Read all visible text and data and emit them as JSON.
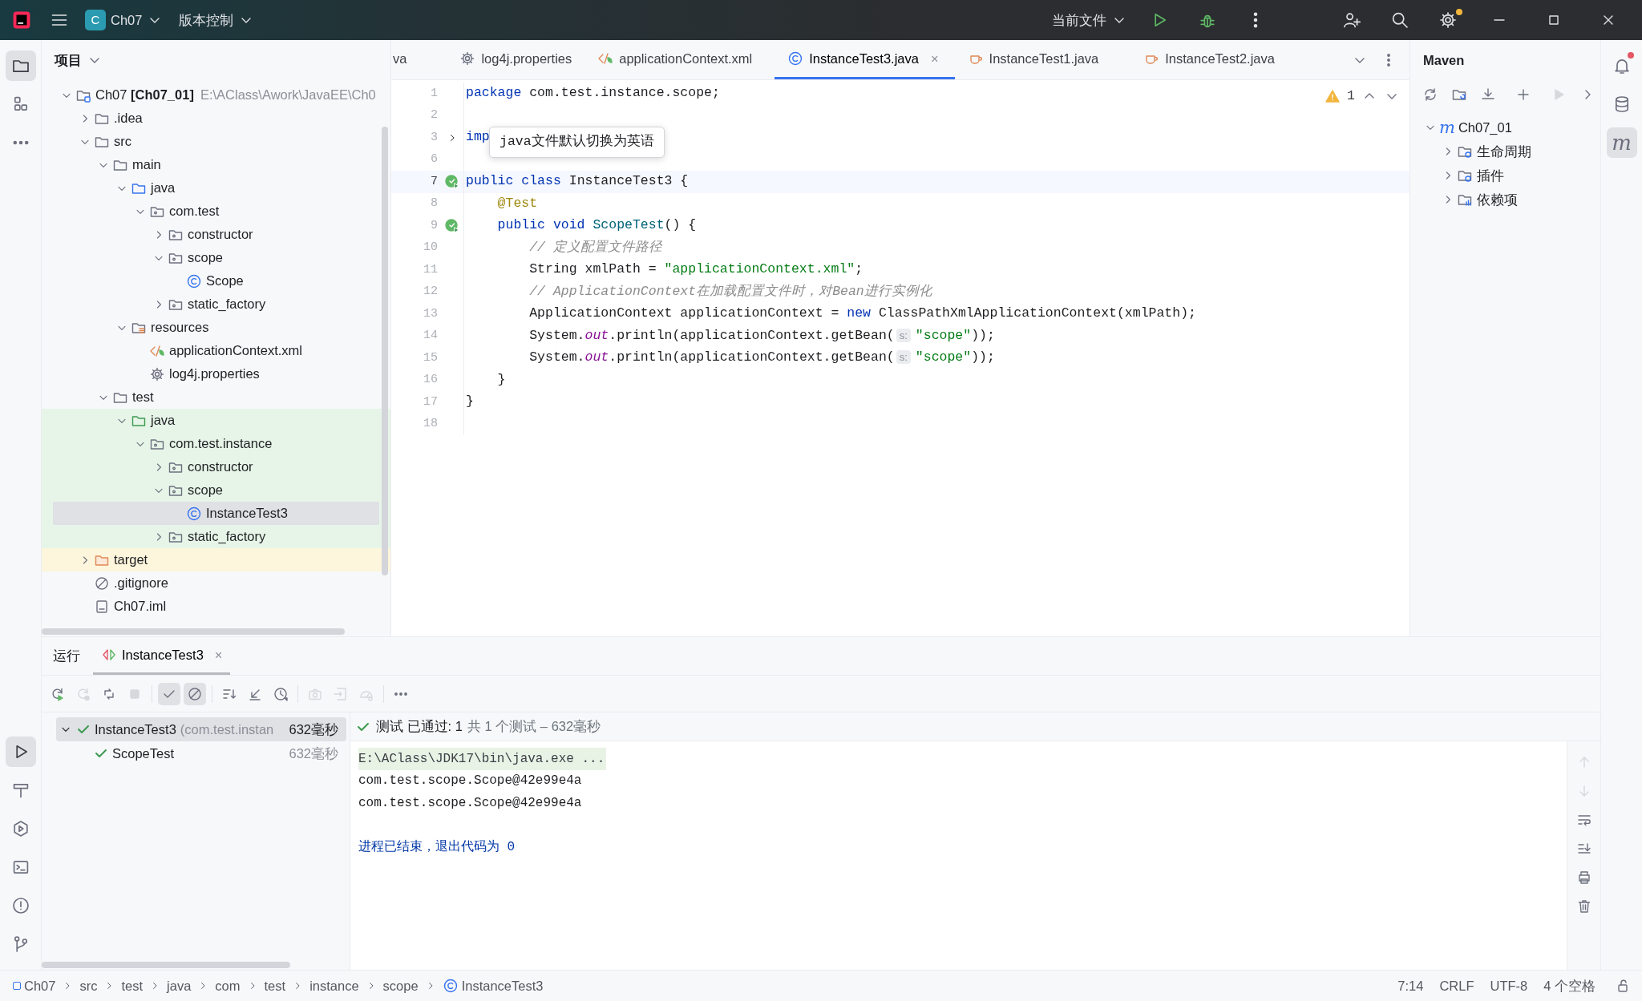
{
  "title_bar": {
    "project_badge": "C",
    "project": "Ch07",
    "vcs": "版本控制",
    "run_config": "当前文件",
    "settings_alert": true
  },
  "left_strip": {
    "top": [
      {
        "kind": "project",
        "selected": true
      },
      {
        "kind": "structure",
        "selected": false
      },
      {
        "kind": "more",
        "selected": false
      }
    ],
    "bottom": [
      {
        "kind": "run",
        "selected": true
      },
      {
        "kind": "build",
        "selected": false
      },
      {
        "kind": "services",
        "selected": false
      },
      {
        "kind": "terminal",
        "selected": false
      },
      {
        "kind": "problems",
        "selected": false
      },
      {
        "kind": "git",
        "selected": false
      }
    ]
  },
  "project_panel": {
    "title": "项目",
    "tree": [
      {
        "label": "Ch07 **[Ch07_01]**",
        "detail": "E:\\AClass\\Awork\\JavaEE\\Ch0",
        "kind": "module",
        "expanded": true,
        "selected": false,
        "children": [
          {
            "label": ".idea",
            "kind": "folder",
            "expanded": false,
            "selected": false
          },
          {
            "label": "src",
            "kind": "folder",
            "expanded": true,
            "selected": false,
            "children": [
              {
                "label": "main",
                "kind": "folder",
                "expanded": true,
                "selected": false,
                "children": [
                  {
                    "label": "java",
                    "kind": "source_root",
                    "expanded": true,
                    "selected": false,
                    "children": [
                      {
                        "label": "com.test",
                        "kind": "package",
                        "expanded": true,
                        "selected": false,
                        "children": [
                          {
                            "label": "constructor",
                            "kind": "package",
                            "expanded": false,
                            "selected": false
                          },
                          {
                            "label": "scope",
                            "kind": "package",
                            "expanded": true,
                            "selected": false,
                            "children": [
                              {
                                "label": "Scope",
                                "kind": "class",
                                "selected": false
                              }
                            ]
                          },
                          {
                            "label": "static_factory",
                            "kind": "package",
                            "expanded": false,
                            "selected": false
                          }
                        ]
                      }
                    ]
                  },
                  {
                    "label": "resources",
                    "kind": "resources",
                    "expanded": true,
                    "selected": false,
                    "children": [
                      {
                        "label": "applicationContext.xml",
                        "kind": "xml",
                        "selected": false
                      },
                      {
                        "label": "log4j.properties",
                        "kind": "properties",
                        "selected": false
                      }
                    ]
                  }
                ]
              },
              {
                "label": "test",
                "kind": "folder",
                "expanded": true,
                "selected": false,
                "children": [
                  {
                    "label": "java",
                    "kind": "test_root",
                    "expanded": true,
                    "selected": false,
                    "children": [
                      {
                        "label": "com.test.instance",
                        "kind": "package",
                        "expanded": true,
                        "selected": false,
                        "children": [
                          {
                            "label": "constructor",
                            "kind": "package",
                            "expanded": false,
                            "selected": false
                          },
                          {
                            "label": "scope",
                            "kind": "package",
                            "expanded": true,
                            "selected": false,
                            "children": [
                              {
                                "label": "InstanceTest3",
                                "kind": "class",
                                "selected": true
                              }
                            ]
                          },
                          {
                            "label": "static_factory",
                            "kind": "package",
                            "expanded": false,
                            "selected": false
                          }
                        ]
                      }
                    ]
                  }
                ]
              }
            ]
          },
          {
            "label": "target",
            "kind": "excluded",
            "expanded": false,
            "selected": false
          },
          {
            "label": ".gitignore",
            "kind": "ignore",
            "selected": false
          },
          {
            "label": "Ch07.iml",
            "kind": "iml",
            "selected": false
          }
        ]
      }
    ]
  },
  "editor_tabs": [
    {
      "label": "va",
      "kind": "cut",
      "selected": false
    },
    {
      "label": "log4j.properties",
      "kind": "properties",
      "selected": false
    },
    {
      "label": "applicationContext.xml",
      "kind": "xml",
      "selected": false
    },
    {
      "label": "InstanceTest3.java",
      "kind": "class",
      "selected": true,
      "close": "×"
    },
    {
      "label": "InstanceTest1.java",
      "kind": "java",
      "selected": false
    },
    {
      "label": "InstanceTest2.java",
      "kind": "java",
      "selected": false
    }
  ],
  "editor": {
    "warnings": "1",
    "tooltip": "java文件默认切换为英语",
    "lines": [
      {
        "number": "1",
        "tokens": [
          {
            "kind": "kw",
            "text": "package"
          },
          {
            "kind": "t",
            "text": " com.test.instance.scope;"
          }
        ]
      },
      {
        "number": "2"
      },
      {
        "number": "3",
        "fold": true,
        "tokens": [
          {
            "kind": "kw",
            "text": "imp"
          }
        ]
      },
      {
        "number": "6"
      },
      {
        "number": "7",
        "current": true,
        "run_marker": true,
        "tokens": [
          {
            "kind": "kw",
            "text": "public class"
          },
          {
            "kind": "t",
            "text": " InstanceTest3 {"
          }
        ]
      },
      {
        "number": "8",
        "tokens": [
          {
            "kind": "ann",
            "text": "    @Test"
          }
        ]
      },
      {
        "number": "9",
        "run_marker": true,
        "tokens": [
          {
            "kind": "kw",
            "text": "    public void"
          },
          {
            "kind": "fn",
            "text": " ScopeTest"
          },
          {
            "kind": "t",
            "text": "() {"
          }
        ]
      },
      {
        "number": "10",
        "tokens": [
          {
            "kind": "cm",
            "text": "        // 定义配置文件路径"
          }
        ]
      },
      {
        "number": "11",
        "tokens": [
          {
            "kind": "t",
            "text": "        String xmlPath = "
          },
          {
            "kind": "str",
            "text": "\"applicationContext.xml\""
          },
          {
            "kind": "t",
            "text": ";"
          }
        ]
      },
      {
        "number": "12",
        "tokens": [
          {
            "kind": "cm",
            "text": "        // ApplicationContext在加载配置文件时，对Bean进行实例化"
          }
        ]
      },
      {
        "number": "13",
        "tokens": [
          {
            "kind": "t",
            "text": "        ApplicationContext applicationContext = "
          },
          {
            "kind": "kw",
            "text": "new"
          },
          {
            "kind": "t",
            "text": " ClassPathXmlApplicationContext(xmlPath);"
          }
        ]
      },
      {
        "number": "14",
        "tokens": [
          {
            "kind": "t",
            "text": "        System."
          },
          {
            "kind": "static",
            "text": "out"
          },
          {
            "kind": "t",
            "text": ".println(applicationContext.getBean("
          },
          {
            "kind": "hint",
            "text": "s:"
          },
          {
            "kind": "str",
            "text": "\"scope\""
          },
          {
            "kind": "t",
            "text": "));"
          }
        ]
      },
      {
        "number": "15",
        "tokens": [
          {
            "kind": "t",
            "text": "        System."
          },
          {
            "kind": "static",
            "text": "out"
          },
          {
            "kind": "t",
            "text": ".println(applicationContext.getBean("
          },
          {
            "kind": "hint",
            "text": "s:"
          },
          {
            "kind": "str",
            "text": "\"scope\""
          },
          {
            "kind": "t",
            "text": "));"
          }
        ]
      },
      {
        "number": "16",
        "tokens": [
          {
            "kind": "t",
            "text": "    }"
          }
        ]
      },
      {
        "number": "17",
        "tokens": [
          {
            "kind": "t",
            "text": "}"
          }
        ]
      },
      {
        "number": "18"
      }
    ]
  },
  "maven": {
    "title": "Maven",
    "toolbar": [
      {
        "kind": "reload",
        "disabled": false
      },
      {
        "kind": "reimport",
        "disabled": false
      },
      {
        "kind": "download",
        "disabled": false
      },
      {
        "kind": "add",
        "disabled": false
      },
      {
        "kind": "execute",
        "disabled": true
      },
      {
        "kind": "expand",
        "disabled": false
      }
    ],
    "tree": [
      {
        "label": "Ch07_01",
        "glyph": "m",
        "expanded": true,
        "children": [
          {
            "label": "生命周期",
            "kind": "lifecycle",
            "expanded": false
          },
          {
            "label": "插件",
            "kind": "plugins",
            "expanded": false
          },
          {
            "label": "依赖项",
            "kind": "dependencies",
            "expanded": false
          }
        ]
      }
    ]
  },
  "right_strip": [
    {
      "kind": "notifications",
      "selected": false,
      "alert": true
    },
    {
      "kind": "database",
      "selected": false
    },
    {
      "kind": "maven",
      "glyph": "m",
      "selected": true
    }
  ],
  "run_panel": {
    "title": "运行",
    "tabs": [
      {
        "label": "InstanceTest3",
        "selected": true,
        "close": "×"
      }
    ],
    "toolbar": [
      {
        "kind": "rerun",
        "disabled": false,
        "selected": false
      },
      {
        "kind": "rerun_failed",
        "disabled": true,
        "selected": false
      },
      {
        "kind": "auto_rerun",
        "disabled": false,
        "selected": false
      },
      {
        "kind": "stop",
        "disabled": true,
        "selected": false
      },
      {
        "kind": "show_passed",
        "disabled": false,
        "selected": true
      },
      {
        "kind": "show_ignored",
        "disabled": false,
        "selected": true
      },
      {
        "kind": "sort",
        "disabled": false,
        "selected": false
      },
      {
        "kind": "collapse",
        "disabled": false,
        "selected": false
      },
      {
        "kind": "history",
        "disabled": false,
        "selected": false
      },
      {
        "kind": "snapshot",
        "disabled": true,
        "selected": false
      },
      {
        "kind": "export",
        "disabled": true,
        "selected": false
      },
      {
        "kind": "coverage",
        "disabled": true,
        "selected": false
      },
      {
        "kind": "more",
        "disabled": false,
        "selected": false
      }
    ],
    "tests": [
      {
        "label": "InstanceTest3",
        "detail": "(com.test.instan",
        "time": "632毫秒",
        "passed": true,
        "expanded": true,
        "selected": true,
        "children": [
          {
            "label": "ScopeTest",
            "time": "632毫秒",
            "passed": true,
            "selected": false
          }
        ]
      }
    ],
    "summary_passed": true,
    "summary": "测试 已通过: 1",
    "summary_detail": "共 1 个测试 – 632毫秒",
    "console": [
      {
        "kind": "command",
        "text": "E:\\AClass\\JDK17\\bin\\java.exe ..."
      },
      {
        "kind": "output",
        "text": "com.test.scope.Scope@42e99e4a"
      },
      {
        "kind": "output",
        "text": "com.test.scope.Scope@42e99e4a"
      },
      {
        "kind": "exit",
        "text": "进程已结束，退出代码为 0"
      }
    ],
    "console_toolbar": [
      {
        "kind": "up",
        "disabled": true
      },
      {
        "kind": "down",
        "disabled": true
      },
      {
        "kind": "wrap",
        "disabled": false
      },
      {
        "kind": "scroll_end",
        "disabled": false
      },
      {
        "kind": "print",
        "disabled": false
      },
      {
        "kind": "clear",
        "disabled": false
      }
    ]
  },
  "status_bar": {
    "breadcrumbs": [
      {
        "label": "Ch07",
        "kind": "module"
      },
      {
        "label": "src",
        "kind": "folder"
      },
      {
        "label": "test",
        "kind": "folder"
      },
      {
        "label": "java",
        "kind": "folder"
      },
      {
        "label": "com",
        "kind": "folder"
      },
      {
        "label": "test",
        "kind": "folder"
      },
      {
        "label": "instance",
        "kind": "folder"
      },
      {
        "label": "scope",
        "kind": "folder"
      },
      {
        "label": "InstanceTest3",
        "kind": "class"
      }
    ],
    "position": "7:14",
    "line_separator": "CRLF",
    "encoding": "UTF-8",
    "indent": "4 个空格"
  }
}
